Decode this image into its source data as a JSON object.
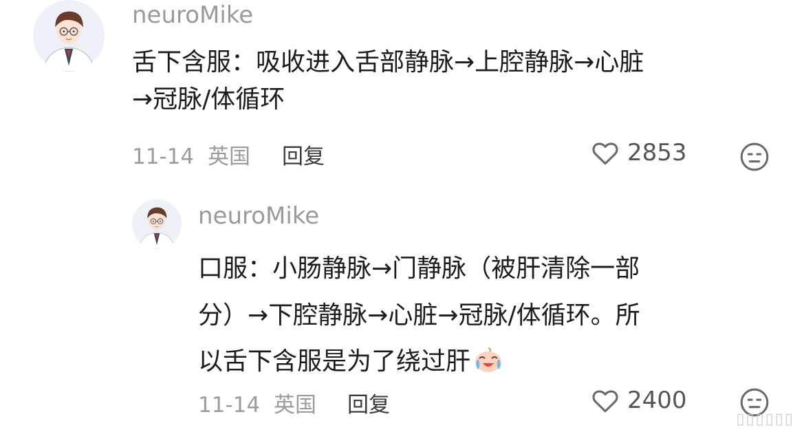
{
  "colors": {
    "username": "#9a9a9a",
    "text": "#1c1c1c",
    "meta": "#9c9c9c",
    "icon": "#6a6a6a"
  },
  "comment": {
    "username": "neuroMike",
    "line1": "舌下含服：吸收进入舌部静脉→上腔静脉→心脏",
    "line2": "→冠脉/体循环",
    "date": "11-14",
    "location": "英国",
    "reply_label": "回复",
    "likes": "2853",
    "like_icon": "heart-outline-icon",
    "dislike_icon": "neutral-face-icon"
  },
  "reply": {
    "username": "neuroMike",
    "line1": "口服：小肠静脉→门静脉（被肝清除一部",
    "line2": "分）→下腔静脉→心脏→冠脉/体循环。所",
    "line3": "以舌下含服是为了绕过肝",
    "emoji": "crying-face-emoji",
    "date": "11-14",
    "location": "英国",
    "reply_label": "回复",
    "likes": "2400",
    "like_icon": "heart-outline-icon",
    "dislike_icon": "neutral-face-icon"
  },
  "watermark": "▯▯▯▯▯▯"
}
